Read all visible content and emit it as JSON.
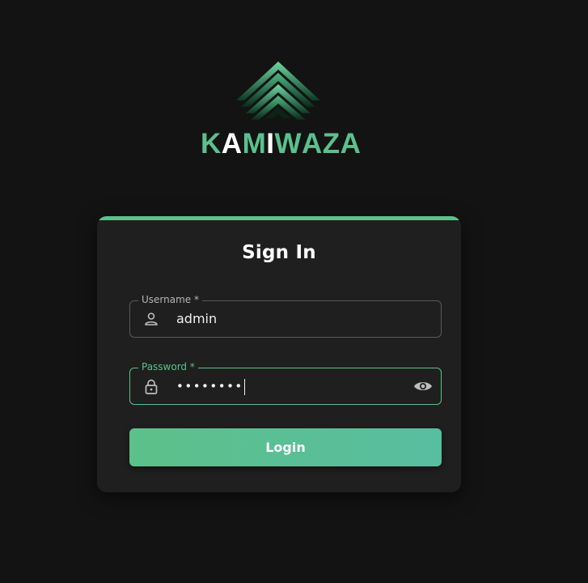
{
  "brand": {
    "logo_icon": "kamiwaza-chevrons-logo",
    "wordmark_letters": [
      {
        "char": "K",
        "color": "#5cc08e"
      },
      {
        "char": "A",
        "color": "#ffffff"
      },
      {
        "char": "M",
        "color": "#5cc08e"
      },
      {
        "char": "I",
        "color": "#ffffff"
      },
      {
        "char": "W",
        "color": "#5cc08e"
      },
      {
        "char": "A",
        "color": "#5cc08e"
      },
      {
        "char": "Z",
        "color": "#5cc08e"
      },
      {
        "char": "A",
        "color": "#5cc08e"
      }
    ],
    "accent_color": "#5cc08e"
  },
  "signin": {
    "title": "Sign In",
    "username": {
      "label": "Username *",
      "value": "admin",
      "icon": "person-icon"
    },
    "password": {
      "label": "Password *",
      "value": "••••••••",
      "icon": "lock-icon",
      "toggle_icon": "eye-icon"
    },
    "login_label": "Login"
  }
}
